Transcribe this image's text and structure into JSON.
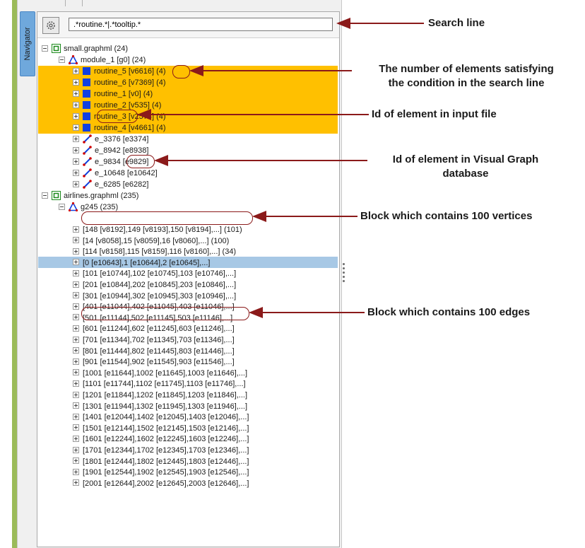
{
  "navigator": {
    "tab_label": "Navigator"
  },
  "search": {
    "value": ".*routine.*|.*tooltip.*"
  },
  "tree": {
    "root1": "small.graphml (24)",
    "module": "module_1 [g0] (24)",
    "routines": [
      "routine_5 [v6616] (4)",
      "routine_6 [v7369] (4)",
      "routine_1 [v0] (4)",
      "routine_2 [v535] (4)",
      "routine_3 [v2574] (4)",
      "routine_4 [v4661] (4)"
    ],
    "edges": [
      "e_3376 [e3374]",
      "e_8942 [e8938]",
      "e_9834 [e9829]",
      "e_10648 [e10642]",
      "e_6285 [e6282]"
    ],
    "root2": "airlines.graphml (235)",
    "group": "g245 (235)",
    "blocks": [
      "[148 [v8192],149 [v8193],150 [v8194],...] (101)",
      "[14 [v8058],15 [v8059],16 [v8060],...] (100)",
      "[114 [v8158],115 [v8159],116 [v8160],...] (34)",
      "[0 [e10643],1 [e10644],2 [e10645],...]",
      "[101 [e10744],102 [e10745],103 [e10746],...]",
      "[201 [e10844],202 [e10845],203 [e10846],...]",
      "[301 [e10944],302 [e10945],303 [e10946],...]",
      "[401 [e11044],402 [e11045],403 [e11046],...]",
      "[501 [e11144],502 [e11145],503 [e11146],...]",
      "[601 [e11244],602 [e11245],603 [e11246],...]",
      "[701 [e11344],702 [e11345],703 [e11346],...]",
      "[801 [e11444],802 [e11445],803 [e11446],...]",
      "[901 [e11544],902 [e11545],903 [e11546],...]",
      "[1001 [e11644],1002 [e11645],1003 [e11646],...]",
      "[1101 [e11744],1102 [e11745],1103 [e11746],...]",
      "[1201 [e11844],1202 [e11845],1203 [e11846],...]",
      "[1301 [e11944],1302 [e11945],1303 [e11946],...]",
      "[1401 [e12044],1402 [e12045],1403 [e12046],...]",
      "[1501 [e12144],1502 [e12145],1503 [e12146],...]",
      "[1601 [e12244],1602 [e12245],1603 [e12246],...]",
      "[1701 [e12344],1702 [e12345],1703 [e12346],...]",
      "[1801 [e12444],1802 [e12445],1803 [e12446],...]",
      "[1901 [e12544],1902 [e12545],1903 [e12546],...]",
      "[2001 [e12644],2002 [e12645],2003 [e12646],...]"
    ]
  },
  "annotations": {
    "search_line": "Search line",
    "count_line1": "The number of elements satisfying",
    "count_line2": "the condition in the search line",
    "id_input": "Id of element in input file",
    "id_db_line1": "Id of element in Visual Graph",
    "id_db_line2": "database",
    "block_vertices": "Block which contains 100 vertices",
    "block_edges": "Block which contains 100 edges"
  },
  "colors": {
    "match_highlight": "#ffc000",
    "selected_row": "#a7c8e5",
    "annotation_arrow": "#8b1a1a",
    "side_bar": "#9bbb59"
  }
}
